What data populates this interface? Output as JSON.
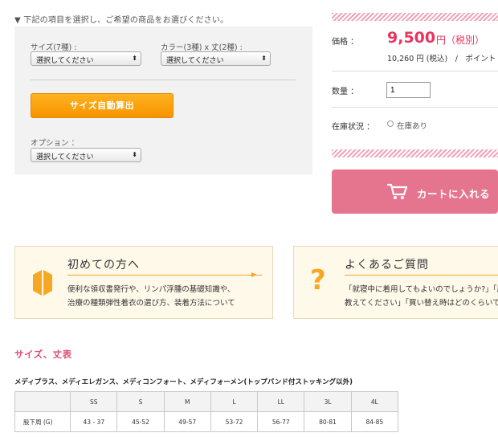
{
  "options": {
    "instruction": "▼ 下記の項目を選択し、ご希望の商品をお選びください。",
    "size_label": "サイズ(7種) :",
    "size_value": "選択してください",
    "color_label": "カラー(3種) x 丈(2種) :",
    "color_value": "選択してください",
    "auto_calc_button": "サイズ自動算出",
    "option_label": "オプション ：",
    "option_value": "選択してください"
  },
  "purchase": {
    "price_label": "価格 ：",
    "price_value": "9,500",
    "price_unit": "円（税別）",
    "price_tax": "10,260 円 (税込)　/　ポイント",
    "qty_label": "数量 ：",
    "qty_value": "1",
    "stock_label": "在庫状況 ：",
    "stock_value": "在庫あり",
    "cart_button": "カートに入れる"
  },
  "cards": {
    "first": {
      "title": "初めての方へ",
      "line1": "便利な領収書発行や、リンパ浮腫の基礎知識や、",
      "line2": "治療の種類弾性着衣の選び方、装着方法について"
    },
    "faq": {
      "title": "よくあるご質問",
      "line1": "「就寝中に着用してもよいのでしょうか?」「圧迫",
      "line2": "教えてください」「買い替え時はどのくらいですか"
    }
  },
  "size_section": {
    "title": "サイズ、丈表",
    "caption": "メディプラス、メディエレガンス、メディコンフォート、メディフォーメン(トップバンド付ストッキング以外)",
    "headers": [
      "",
      "SS",
      "S",
      "M",
      "L",
      "LL",
      "3L",
      "4L"
    ],
    "row_label": "股下周 (G)",
    "row_values": [
      "43 - 37",
      "45-52",
      "49-57",
      "53-72",
      "56-77",
      "80-81",
      "84-85"
    ]
  },
  "colors": {
    "accent_pink": "#e8345e",
    "cart_pink": "#e5758f",
    "orange": "#f79400"
  }
}
